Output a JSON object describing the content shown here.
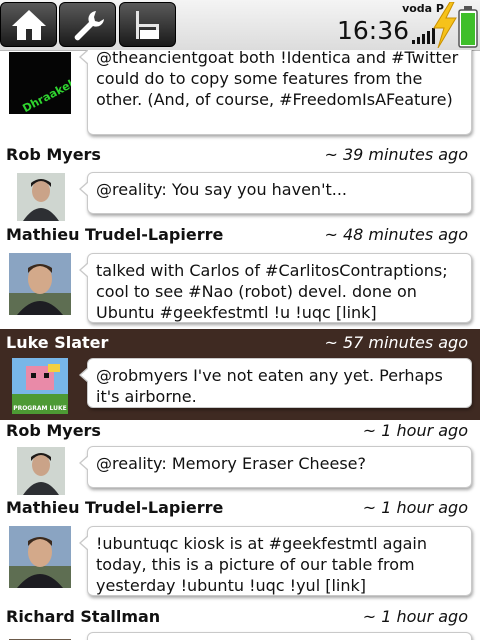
{
  "status": {
    "carrier": "voda P",
    "time": "16:36"
  },
  "toolbar": {
    "home_icon": "home-icon",
    "settings_icon": "wrench-icon",
    "fullscreen_icon": "chair-icon"
  },
  "timeline": [
    {
      "author": "",
      "time": "",
      "avatar_text": "Dhraakellian",
      "text": "@theancientgoat both !Identica and #Twitter could do to copy some features from the other. (And, of course, #FreedomIsAFeature)"
    },
    {
      "author": "Rob Myers",
      "time": "~ 39 minutes ago",
      "text": "@reality: You say you haven't..."
    },
    {
      "author": "Mathieu Trudel-Lapierre",
      "time": "~ 48 minutes ago",
      "text": "talked with Carlos of #CarlitosContraptions; cool to see #Nao (robot) devel. done on Ubuntu #geekfestmtl !u !uqc [link]"
    },
    {
      "author": "Luke Slater",
      "time": "~ 57 minutes ago",
      "avatar_text": "PROGRAM LUKE",
      "text": "@robmyers I've not eaten any yet. Perhaps it's airborne."
    },
    {
      "author": "Rob Myers",
      "time": "~ 1 hour ago",
      "text": "@reality: Memory Eraser Cheese?"
    },
    {
      "author": "Mathieu Trudel-Lapierre",
      "time": "~ 1 hour ago",
      "text": "!ubuntuqc kiosk is at #geekfestmtl again today, this is a picture of our table from yesterday !ubuntu !uqc !yul [link]"
    },
    {
      "author": "Richard Stallman",
      "time": "~ 1 hour ago",
      "text": ""
    }
  ],
  "colors": {
    "selected_row": "#3f2a22",
    "battery": "#3fbf2a",
    "bolt": "#f6c21a"
  }
}
